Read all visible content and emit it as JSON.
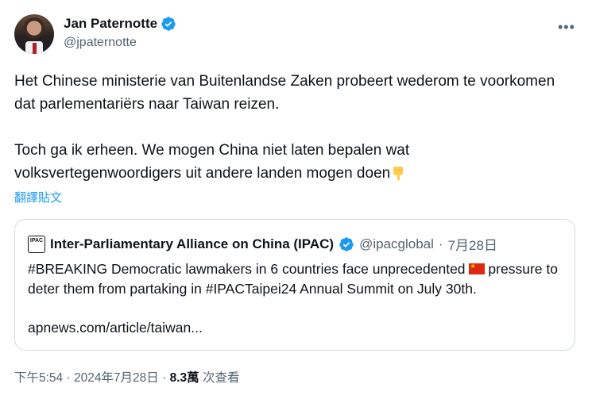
{
  "author": {
    "name": "Jan Paternotte",
    "handle": "@jpaternotte"
  },
  "more_glyph": "•••",
  "tweet": {
    "text": "Het Chinese ministerie van Buitenlandse Zaken probeert wederom te voorkomen dat parlementariërs naar Taiwan reizen.\n\nToch ga ik erheen. We mogen China niet laten bepalen wat volksvertegenwoordigers uit andere landen mogen doen",
    "emoji": "backhand-index-pointing-down-icon",
    "translate_label": "翻譯貼文"
  },
  "quote": {
    "logo_text": "IPAC",
    "name": "Inter-Parliamentary Alliance on China (IPAC)",
    "handle": "@ipacglobal",
    "dot": "·",
    "date": "7月28日",
    "text": "#BREAKING Democratic lawmakers in 6 countries face unprecedented",
    "text_cont": "pressure to deter them from partaking in #IPACTaipei24 Annual Summit on July 30th.",
    "link": "apnews.com/article/taiwan..."
  },
  "footer": {
    "time": "下午5:54",
    "sep": " · ",
    "date": "2024年7月28日",
    "views_count": "8.3萬",
    "views_label": " 次查看"
  },
  "colors": {
    "accent": "#1d9bf0",
    "muted": "#536471",
    "text": "#0f1419",
    "border": "#cfd9de"
  }
}
